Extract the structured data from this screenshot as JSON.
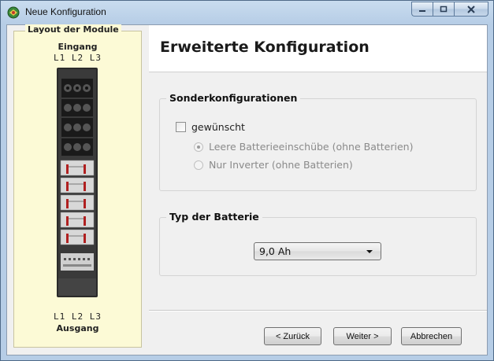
{
  "window": {
    "title": "Neue Konfiguration",
    "accent": "#b6cde6"
  },
  "sidebar": {
    "legend": "Layout der Module",
    "input_label": "Eingang",
    "input_phases": "L1  L2  L3",
    "output_phases": "L1  L2  L3",
    "output_label": "Ausgang"
  },
  "header": {
    "title": "Erweiterte Konfiguration"
  },
  "special_config": {
    "legend": "Sonderkonfigurationen",
    "checkbox_label": "gewünscht",
    "checked": false,
    "options": [
      {
        "label": "Leere Batterieeinschübe (ohne Batterien)",
        "selected": true,
        "enabled": false
      },
      {
        "label": "Nur Inverter (ohne Batterien)",
        "selected": false,
        "enabled": false
      }
    ]
  },
  "battery_type": {
    "legend": "Typ der Batterie",
    "selected": "9,0 Ah"
  },
  "footer": {
    "back_label": "< Zurück",
    "next_label": "Weiter >",
    "cancel_label": "Abbrechen"
  }
}
